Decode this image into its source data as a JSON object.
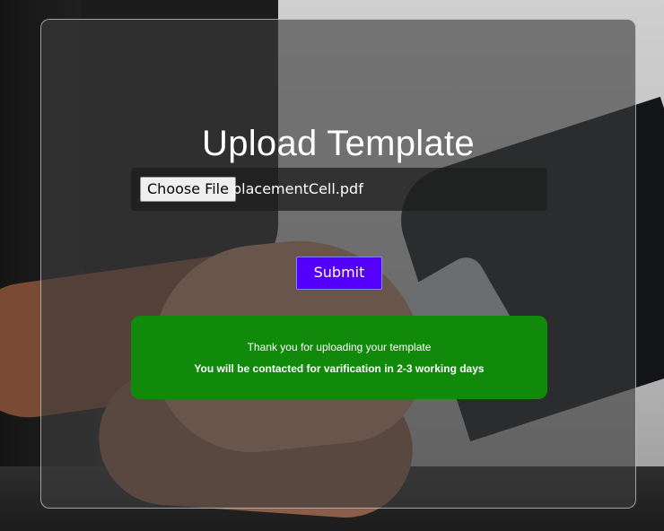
{
  "page": {
    "title": "Upload Template"
  },
  "upload": {
    "choose_file_label": "Choose File",
    "file_name": "placementCell.pdf"
  },
  "submit": {
    "label": "Submit"
  },
  "alert": {
    "message": "Thank you for uploading your template",
    "detail": "You will be contacted for varification in 2-3 working days"
  },
  "colors": {
    "submit_bg": "#5500ff",
    "alert_bg": "#118a0b"
  }
}
